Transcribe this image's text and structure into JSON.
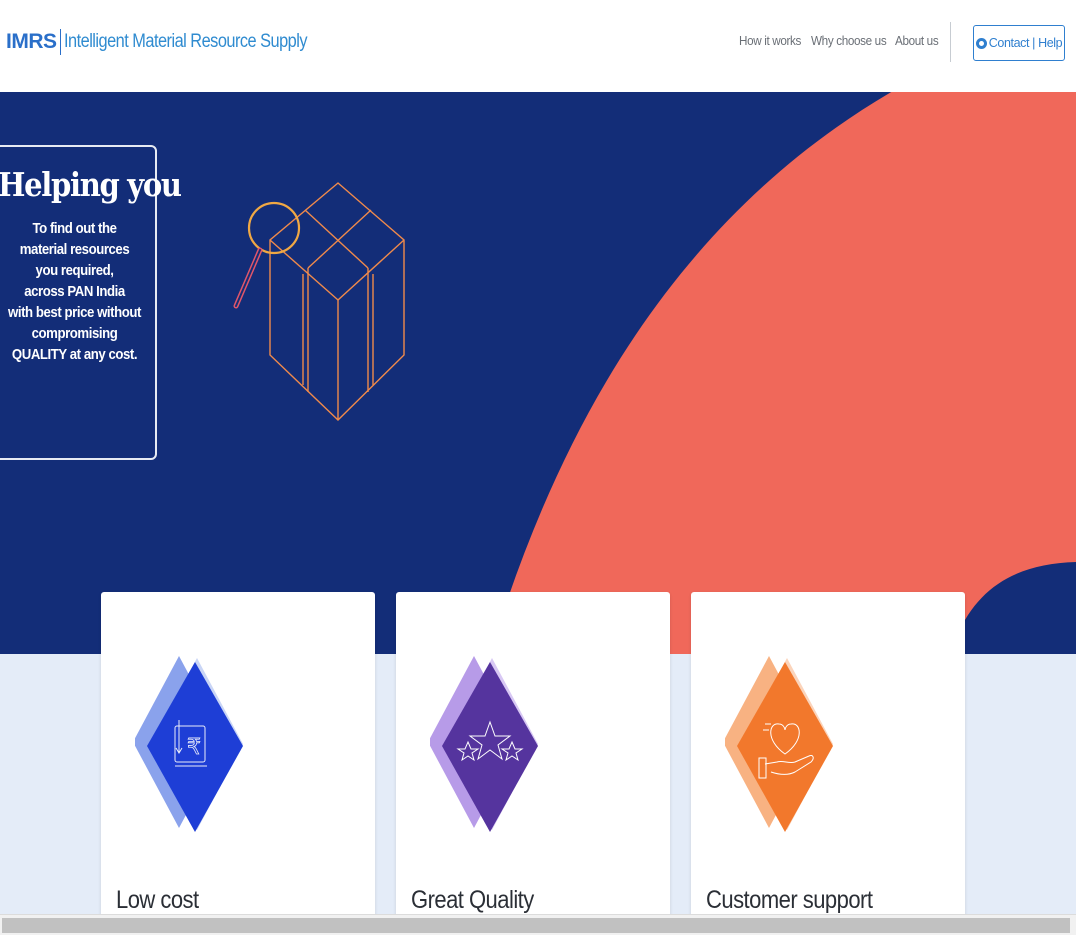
{
  "header": {
    "brand_short": "IMRS",
    "brand_full": "Intelligent Material Resource Supply",
    "nav": [
      "How it works",
      "Why choose us",
      "About us"
    ],
    "contact_label": "Contact | Help"
  },
  "hero": {
    "title": "Helping you",
    "lines": [
      "To find out the",
      "material resources",
      "you required,",
      "across PAN India",
      "with best price without",
      "compromising",
      "QUALITY at any cost."
    ]
  },
  "cards": [
    {
      "title": "Low cost",
      "icon": "rupee-price-down-icon"
    },
    {
      "title": "Great Quality",
      "icon": "stars-icon"
    },
    {
      "title": "Customer support",
      "icon": "heart-hand-icon"
    }
  ],
  "colors": {
    "navy": "#132d78",
    "coral": "#f0685a",
    "light_bg": "#e4ecf8",
    "brand_blue": "#2a6fc9",
    "card1": "#1e3ed6",
    "card2": "#55349e",
    "card3": "#f2782c"
  }
}
